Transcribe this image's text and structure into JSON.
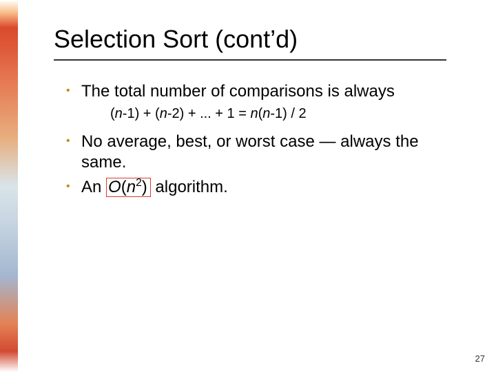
{
  "title": "Selection Sort (cont’d)",
  "bullets": {
    "b1": "The total number of comparisons is always",
    "b2": "No average, best, or worst case — always the same.",
    "b3_prefix": "An ",
    "b3_box_O": "O",
    "b3_box_open": "(",
    "b3_box_n": "n",
    "b3_box_exp": "2",
    "b3_box_close": ")",
    "b3_suffix": " algorithm."
  },
  "formula": {
    "p1": "(",
    "n1": "n",
    "p2": "-1) + (",
    "n2": "n",
    "p3": "-2) + ... + 1 = ",
    "n3": "n",
    "p4": "(",
    "n4": "n",
    "p5": "-1) / 2"
  },
  "page_number": "27"
}
